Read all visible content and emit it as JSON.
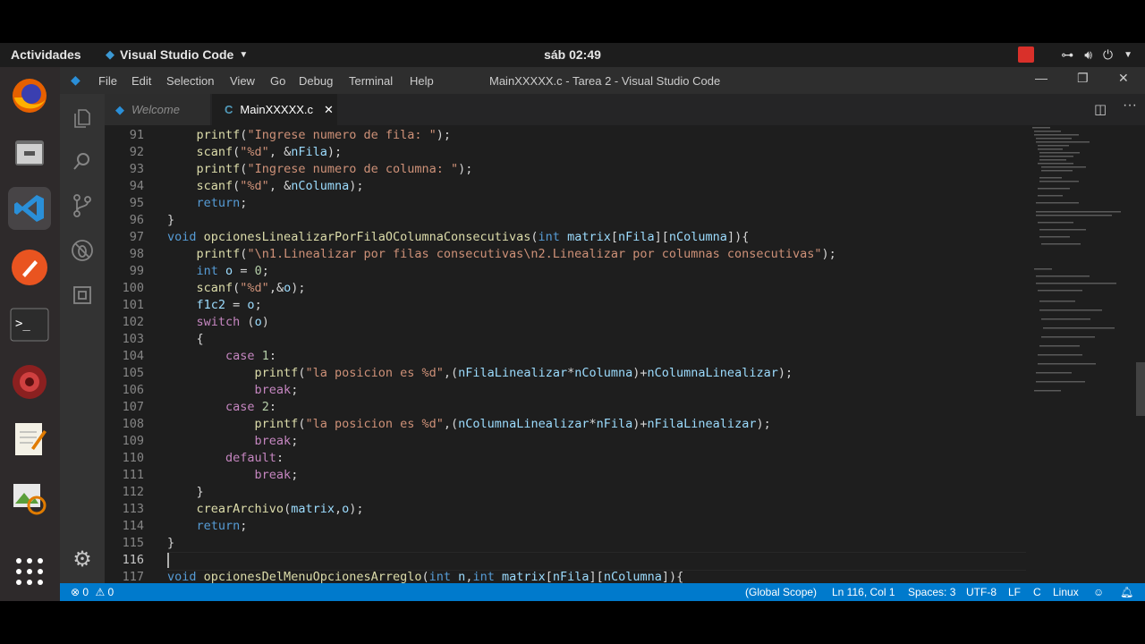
{
  "topbar": {
    "activities": "Actividades",
    "app_name": "Visual Studio Code",
    "clock": "sáb 02:49"
  },
  "window": {
    "menu": [
      "File",
      "Edit",
      "Selection",
      "View",
      "Go",
      "Debug",
      "Terminal",
      "Help"
    ],
    "title": "MainXXXXX.c - Tarea 2 - Visual Studio Code"
  },
  "tabs": [
    {
      "label": "Welcome",
      "active": false
    },
    {
      "label": "MainXXXXX.c",
      "active": true,
      "icon_text": "C"
    }
  ],
  "editor": {
    "current_line": 116,
    "lines": [
      {
        "n": "91",
        "text": "    printf(\"Ingrese numero de fila: \");"
      },
      {
        "n": "92",
        "text": "    scanf(\"%d\", &nFila);"
      },
      {
        "n": "93",
        "text": "    printf(\"Ingrese numero de columna: \");"
      },
      {
        "n": "94",
        "text": "    scanf(\"%d\", &nColumna);"
      },
      {
        "n": "95",
        "text": "    return;"
      },
      {
        "n": "96",
        "text": "}"
      },
      {
        "n": "97",
        "text": "void opcionesLinealizarPorFilaOColumnaConsecutivas(int matrix[nFila][nColumna]){"
      },
      {
        "n": "98",
        "text": "    printf(\"\\n1.Linealizar por filas consecutivas\\n2.Linealizar por columnas consecutivas\");"
      },
      {
        "n": "99",
        "text": "    int o = 0;"
      },
      {
        "n": "100",
        "text": "    scanf(\"%d\",&o);"
      },
      {
        "n": "101",
        "text": "    f1c2 = o;"
      },
      {
        "n": "102",
        "text": "    switch (o)"
      },
      {
        "n": "103",
        "text": "    {"
      },
      {
        "n": "104",
        "text": "        case 1:"
      },
      {
        "n": "105",
        "text": "            printf(\"la posicion es %d\",(nFilaLinealizar*nColumna)+nColumnaLinealizar);"
      },
      {
        "n": "106",
        "text": "            break;"
      },
      {
        "n": "107",
        "text": "        case 2:"
      },
      {
        "n": "108",
        "text": "            printf(\"la posicion es %d\",(nColumnaLinealizar*nFila)+nFilaLinealizar);"
      },
      {
        "n": "109",
        "text": "            break;"
      },
      {
        "n": "110",
        "text": "        default:"
      },
      {
        "n": "111",
        "text": "            break;"
      },
      {
        "n": "112",
        "text": "    }"
      },
      {
        "n": "113",
        "text": "    crearArchivo(matrix,o);"
      },
      {
        "n": "114",
        "text": "    return;"
      },
      {
        "n": "115",
        "text": "}"
      },
      {
        "n": "116",
        "text": ""
      },
      {
        "n": "117",
        "text": "void opcionesDelMenuOpcionesArreglo(int n,int matrix[nFila][nColumna]){"
      }
    ]
  },
  "statusbar": {
    "errors": "0",
    "warnings": "0",
    "scope": "(Global Scope)",
    "position": "Ln 116, Col 1",
    "spaces": "Spaces: 3",
    "encoding": "UTF-8",
    "eol": "LF",
    "language": "C",
    "os": "Linux"
  },
  "colors": {
    "accent": "#007acc",
    "keyword": "#569cd6",
    "function": "#dcdcaa",
    "string": "#ce9178",
    "number": "#b5cea8",
    "variable": "#9cdcfe",
    "control": "#c586c0"
  }
}
